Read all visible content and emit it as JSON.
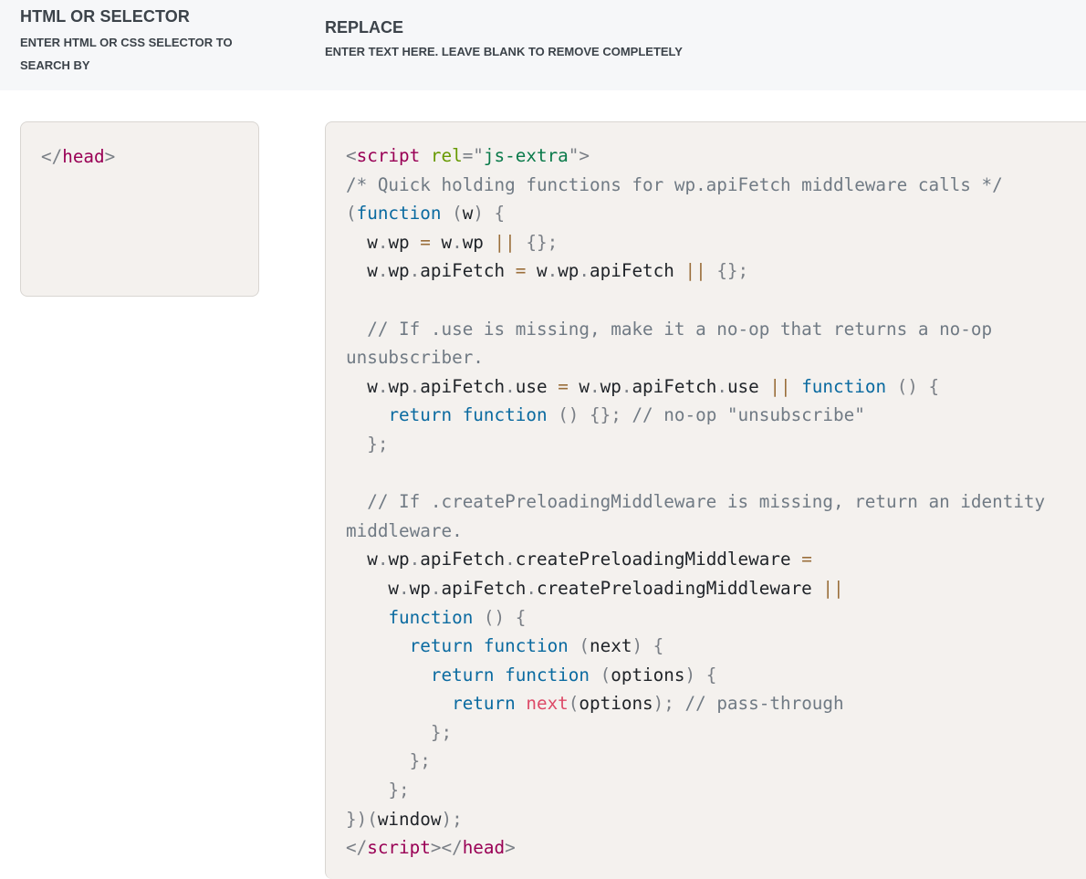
{
  "header": {
    "search_title": "HTML OR SELECTOR",
    "search_subtitle": "ENTER HTML OR CSS SELECTOR TO SEARCH BY",
    "replace_title": "REPLACE",
    "replace_subtitle": "ENTER TEXT HERE. LEAVE BLANK TO REMOVE COMPLETELY"
  },
  "search_field": {
    "tokens": [
      [
        [
          "punct",
          "</"
        ],
        [
          "tag",
          "head"
        ],
        [
          "punct",
          ">"
        ]
      ]
    ]
  },
  "replace_field": {
    "tokens": [
      [
        [
          "punct",
          "<"
        ],
        [
          "tag",
          "script"
        ],
        [
          "plain",
          " "
        ],
        [
          "attr",
          "rel"
        ],
        [
          "punct",
          "=\""
        ],
        [
          "str",
          "js-extra"
        ],
        [
          "punct",
          "\">"
        ]
      ],
      [
        [
          "comment",
          "/* Quick holding functions for wp.apiFetch middleware calls */"
        ]
      ],
      [
        [
          "punct",
          "("
        ],
        [
          "kw",
          "function"
        ],
        [
          "plain",
          " "
        ],
        [
          "punct",
          "("
        ],
        [
          "plain",
          "w"
        ],
        [
          "punct",
          ")"
        ],
        [
          "plain",
          " "
        ],
        [
          "punct",
          "{"
        ]
      ],
      [
        [
          "plain",
          "  w"
        ],
        [
          "punct",
          "."
        ],
        [
          "plain",
          "wp "
        ],
        [
          "op",
          "="
        ],
        [
          "plain",
          " w"
        ],
        [
          "punct",
          "."
        ],
        [
          "plain",
          "wp "
        ],
        [
          "op",
          "||"
        ],
        [
          "plain",
          " "
        ],
        [
          "punct",
          "{};"
        ]
      ],
      [
        [
          "plain",
          "  w"
        ],
        [
          "punct",
          "."
        ],
        [
          "plain",
          "wp"
        ],
        [
          "punct",
          "."
        ],
        [
          "plain",
          "apiFetch "
        ],
        [
          "op",
          "="
        ],
        [
          "plain",
          " w"
        ],
        [
          "punct",
          "."
        ],
        [
          "plain",
          "wp"
        ],
        [
          "punct",
          "."
        ],
        [
          "plain",
          "apiFetch "
        ],
        [
          "op",
          "||"
        ],
        [
          "plain",
          " "
        ],
        [
          "punct",
          "{};"
        ]
      ],
      [
        [
          "plain",
          ""
        ]
      ],
      [
        [
          "comment",
          "  // If .use is missing, make it a no-op that returns a no-op"
        ]
      ],
      [
        [
          "comment",
          "unsubscriber."
        ]
      ],
      [
        [
          "plain",
          "  w"
        ],
        [
          "punct",
          "."
        ],
        [
          "plain",
          "wp"
        ],
        [
          "punct",
          "."
        ],
        [
          "plain",
          "apiFetch"
        ],
        [
          "punct",
          "."
        ],
        [
          "plain",
          "use "
        ],
        [
          "op",
          "="
        ],
        [
          "plain",
          " w"
        ],
        [
          "punct",
          "."
        ],
        [
          "plain",
          "wp"
        ],
        [
          "punct",
          "."
        ],
        [
          "plain",
          "apiFetch"
        ],
        [
          "punct",
          "."
        ],
        [
          "plain",
          "use "
        ],
        [
          "op",
          "||"
        ],
        [
          "plain",
          " "
        ],
        [
          "kw",
          "function"
        ],
        [
          "plain",
          " "
        ],
        [
          "punct",
          "()"
        ],
        [
          "plain",
          " "
        ],
        [
          "punct",
          "{"
        ]
      ],
      [
        [
          "plain",
          "    "
        ],
        [
          "kw",
          "return"
        ],
        [
          "plain",
          " "
        ],
        [
          "kw",
          "function"
        ],
        [
          "plain",
          " "
        ],
        [
          "punct",
          "()"
        ],
        [
          "plain",
          " "
        ],
        [
          "punct",
          "{};"
        ],
        [
          "plain",
          " "
        ],
        [
          "comment",
          "// no-op \"unsubscribe\""
        ]
      ],
      [
        [
          "plain",
          "  "
        ],
        [
          "punct",
          "};"
        ]
      ],
      [
        [
          "plain",
          ""
        ]
      ],
      [
        [
          "comment",
          "  // If .createPreloadingMiddleware is missing, return an identity"
        ]
      ],
      [
        [
          "comment",
          "middleware."
        ]
      ],
      [
        [
          "plain",
          "  w"
        ],
        [
          "punct",
          "."
        ],
        [
          "plain",
          "wp"
        ],
        [
          "punct",
          "."
        ],
        [
          "plain",
          "apiFetch"
        ],
        [
          "punct",
          "."
        ],
        [
          "plain",
          "createPreloadingMiddleware "
        ],
        [
          "op",
          "="
        ]
      ],
      [
        [
          "plain",
          "    w"
        ],
        [
          "punct",
          "."
        ],
        [
          "plain",
          "wp"
        ],
        [
          "punct",
          "."
        ],
        [
          "plain",
          "apiFetch"
        ],
        [
          "punct",
          "."
        ],
        [
          "plain",
          "createPreloadingMiddleware "
        ],
        [
          "op",
          "||"
        ]
      ],
      [
        [
          "plain",
          "    "
        ],
        [
          "kw",
          "function"
        ],
        [
          "plain",
          " "
        ],
        [
          "punct",
          "()"
        ],
        [
          "plain",
          " "
        ],
        [
          "punct",
          "{"
        ]
      ],
      [
        [
          "plain",
          "      "
        ],
        [
          "kw",
          "return"
        ],
        [
          "plain",
          " "
        ],
        [
          "kw",
          "function"
        ],
        [
          "plain",
          " "
        ],
        [
          "punct",
          "("
        ],
        [
          "plain",
          "next"
        ],
        [
          "punct",
          ")"
        ],
        [
          "plain",
          " "
        ],
        [
          "punct",
          "{"
        ]
      ],
      [
        [
          "plain",
          "        "
        ],
        [
          "kw",
          "return"
        ],
        [
          "plain",
          " "
        ],
        [
          "kw",
          "function"
        ],
        [
          "plain",
          " "
        ],
        [
          "punct",
          "("
        ],
        [
          "plain",
          "options"
        ],
        [
          "punct",
          ")"
        ],
        [
          "plain",
          " "
        ],
        [
          "punct",
          "{"
        ]
      ],
      [
        [
          "plain",
          "          "
        ],
        [
          "kw",
          "return"
        ],
        [
          "plain",
          " "
        ],
        [
          "fn",
          "next"
        ],
        [
          "punct",
          "("
        ],
        [
          "plain",
          "options"
        ],
        [
          "punct",
          ");"
        ],
        [
          "plain",
          " "
        ],
        [
          "comment",
          "// pass-through"
        ]
      ],
      [
        [
          "plain",
          "        "
        ],
        [
          "punct",
          "};"
        ]
      ],
      [
        [
          "plain",
          "      "
        ],
        [
          "punct",
          "};"
        ]
      ],
      [
        [
          "plain",
          "    "
        ],
        [
          "punct",
          "};"
        ]
      ],
      [
        [
          "punct",
          "})("
        ],
        [
          "plain",
          "window"
        ],
        [
          "punct",
          ");"
        ]
      ],
      [
        [
          "punct",
          "</"
        ],
        [
          "tag",
          "script"
        ],
        [
          "punct",
          "></"
        ],
        [
          "tag",
          "head"
        ],
        [
          "punct",
          ">"
        ]
      ]
    ]
  }
}
